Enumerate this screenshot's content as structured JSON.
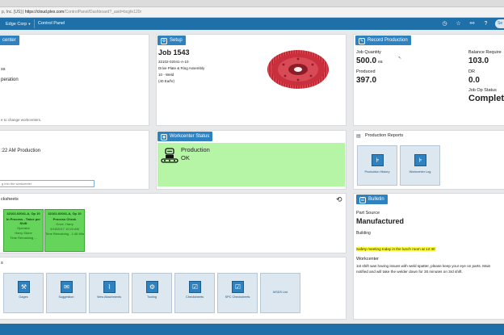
{
  "browser": {
    "url_prefix": "p, Inc. [US]",
    "url_host": "https://cloud.plex.com",
    "url_path": "/ControlPanel/Dashboard?_asid=bcgfe120r"
  },
  "appbar": {
    "company": "Edge Corp",
    "title": "Control Panel",
    "avatar_text": "Se"
  },
  "workcenter_card": {
    "title_partial": "center",
    "line1": "ss",
    "line2": "peration",
    "hint": "e to change workcenters."
  },
  "setup": {
    "tab_label": "Setup",
    "job": "Job 1543",
    "part_no": "32102-02041-A-10",
    "part_desc": "Drive Plate & Ring Assembly",
    "op": "10 - Weld",
    "rate": "(40 Ea/hr)"
  },
  "record_production": {
    "tab_label": "Record Production",
    "job_qty_label": "Job Quantity",
    "job_qty_value": "500.0",
    "job_qty_unit": "ea",
    "produced_label": "Produced",
    "produced_value": "397.0",
    "balance_label": "Balance Require",
    "balance_value": "103.0",
    "dr_label": "DR",
    "dr_value": "0.0",
    "job_op_status_label": "Job Op Status",
    "job_op_status_value": "Complete"
  },
  "log_card": {
    "line": ":22 AM Production",
    "input_placeholder": "g into the workcenter"
  },
  "workcenter_status": {
    "tab_label": "Workcenter Status",
    "status_line1": "Production",
    "status_line2": "OK"
  },
  "production_reports": {
    "title": "Production Reports",
    "buttons": [
      {
        "label": "Production History"
      },
      {
        "label": "Workcenter Log"
      }
    ]
  },
  "checksheets": {
    "title_partial": "cksheets",
    "items": [
      {
        "id": "32102-02041-A, Op 10",
        "status": "In Process - Twice per Shift",
        "role": "Operator",
        "name": "Harry Stone",
        "extra": "Time Remaining ..."
      },
      {
        "id": "32102-02041-A, Op 10",
        "status": "Process Check",
        "name": "Gove, Harry",
        "date": "9/18/2017 10:20 AM",
        "extra": "Time Remaining - 1:46 Min"
      }
    ]
  },
  "tiles_card": {
    "title_partial": "s",
    "tiles": [
      {
        "label": "Gages",
        "icon": "gage-icon"
      },
      {
        "label": "Suggestion",
        "icon": "chat-icon"
      },
      {
        "label": "View Attachments",
        "icon": "paperclip-icon"
      },
      {
        "label": "Tooling",
        "icon": "tooling-icon"
      },
      {
        "label": "Checksheets",
        "icon": "checksheet-icon"
      },
      {
        "label": "SPC Checksheets",
        "icon": "spc-icon"
      },
      {
        "label": "MSDS List",
        "icon": ""
      }
    ]
  },
  "bulletin": {
    "tab_label": "Bulletin",
    "part_source_label": "Part Source",
    "part_source_value": "Manufactured",
    "building_label": "Building",
    "safety_msg": "Safety meeting today in the lunch room at 12:30",
    "workcenter_label": "Workcenter",
    "wc_msg1": "1st shift was having issues with weld spatter, please keep your eye on parts.  Main",
    "wc_msg2": "notified and will take the welder down for 30 minutes on 3rd shift."
  },
  "colors": {
    "brand": "#1f6fa8",
    "tab": "#2e82bf",
    "status_ok": "#b5f5a5",
    "sheet_green": "#64d45a",
    "highlight": "#fffc3a"
  }
}
